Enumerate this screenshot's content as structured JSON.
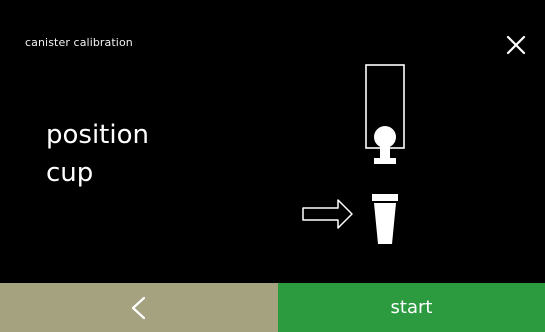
{
  "header": {
    "title": "canister calibration",
    "close_icon": "close-icon"
  },
  "main": {
    "instruction_line1": "position",
    "instruction_line2": "cup",
    "illustration_icons": [
      "canister-icon",
      "dispense-outlet-icon",
      "arrow-right-icon",
      "cup-icon"
    ]
  },
  "footer": {
    "back_icon": "chevron-left-icon",
    "start_label": "start",
    "back_color": "#a5a280",
    "start_color": "#2c9a3f"
  }
}
